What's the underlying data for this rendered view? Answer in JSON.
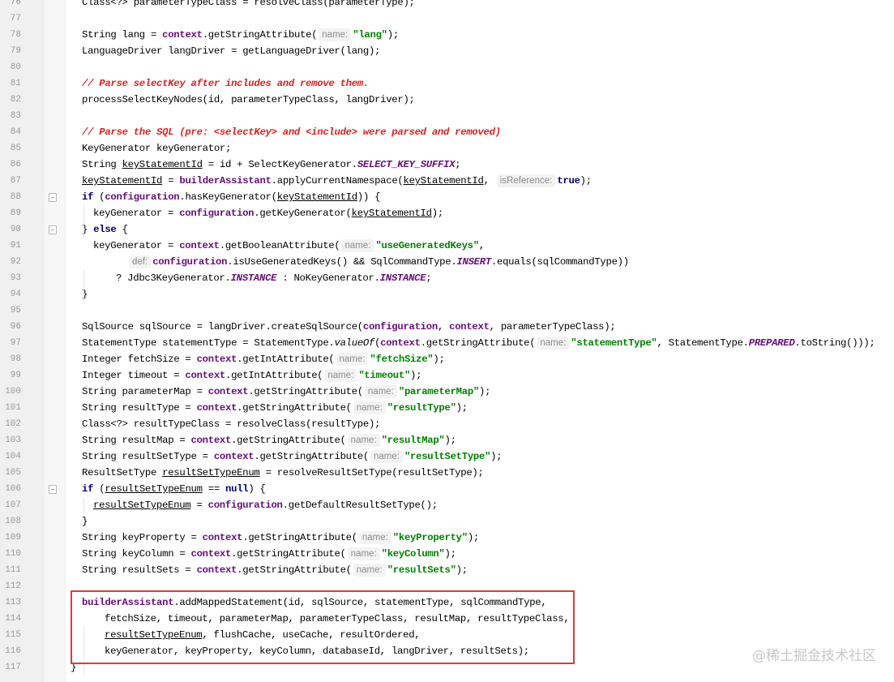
{
  "editor": {
    "lines": [
      {
        "num": "76",
        "fold": false,
        "indent": 0,
        "tokens": [
          {
            "t": "Class<?> parameterTypeClass = resolveClass(parameterType);",
            "c": ""
          }
        ]
      },
      {
        "num": "77",
        "fold": false,
        "indent": 0,
        "tokens": []
      },
      {
        "num": "78",
        "fold": false,
        "indent": 0,
        "tokens": [
          {
            "t": "String lang = ",
            "c": ""
          },
          {
            "t": "context",
            "c": "fld"
          },
          {
            "t": ".getStringAttribute(",
            "c": ""
          },
          {
            "t": "name:",
            "c": "hint"
          },
          {
            "t": "\"lang\"",
            "c": "str"
          },
          {
            "t": ");",
            "c": ""
          }
        ]
      },
      {
        "num": "79",
        "fold": false,
        "indent": 0,
        "tokens": [
          {
            "t": "LanguageDriver langDriver = getLanguageDriver(lang);",
            "c": ""
          }
        ]
      },
      {
        "num": "80",
        "fold": false,
        "indent": 0,
        "tokens": []
      },
      {
        "num": "81",
        "fold": false,
        "indent": 0,
        "tokens": [
          {
            "t": "// Parse selectKey after includes and remove them.",
            "c": "cmt"
          }
        ]
      },
      {
        "num": "82",
        "fold": false,
        "indent": 0,
        "tokens": [
          {
            "t": "processSelectKeyNodes(id, parameterTypeClass, langDriver);",
            "c": ""
          }
        ]
      },
      {
        "num": "83",
        "fold": false,
        "indent": 0,
        "tokens": []
      },
      {
        "num": "84",
        "fold": false,
        "indent": 0,
        "tokens": [
          {
            "t": "// Parse the SQL (pre: <selectKey> and <include> were parsed and removed)",
            "c": "cmt"
          }
        ]
      },
      {
        "num": "85",
        "fold": false,
        "indent": 0,
        "tokens": [
          {
            "t": "KeyGenerator keyGenerator;",
            "c": ""
          }
        ]
      },
      {
        "num": "86",
        "fold": false,
        "indent": 0,
        "tokens": [
          {
            "t": "String ",
            "c": ""
          },
          {
            "t": "keyStatementId",
            "c": "under"
          },
          {
            "t": " = id + SelectKeyGenerator.",
            "c": ""
          },
          {
            "t": "SELECT_KEY_SUFFIX",
            "c": "sfld"
          },
          {
            "t": ";",
            "c": ""
          }
        ]
      },
      {
        "num": "87",
        "fold": false,
        "indent": 0,
        "tokens": [
          {
            "t": "keyStatementId",
            "c": "under"
          },
          {
            "t": " = ",
            "c": ""
          },
          {
            "t": "builderAssistant",
            "c": "fld"
          },
          {
            "t": ".applyCurrentNamespace(",
            "c": ""
          },
          {
            "t": "keyStatementId",
            "c": "under"
          },
          {
            "t": ", ",
            "c": ""
          },
          {
            "t": "isReference:",
            "c": "hint"
          },
          {
            "t": "true",
            "c": "kw"
          },
          {
            "t": ");",
            "c": ""
          }
        ]
      },
      {
        "num": "88",
        "fold": true,
        "indent": 0,
        "tokens": [
          {
            "t": "if",
            "c": "kw"
          },
          {
            "t": " (",
            "c": ""
          },
          {
            "t": "configuration",
            "c": "fld"
          },
          {
            "t": ".hasKeyGenerator(",
            "c": ""
          },
          {
            "t": "keyStatementId",
            "c": "under"
          },
          {
            "t": ")) {",
            "c": ""
          }
        ]
      },
      {
        "num": "89",
        "fold": false,
        "indent": 1,
        "tokens": [
          {
            "t": "keyGenerator = ",
            "c": ""
          },
          {
            "t": "configuration",
            "c": "fld"
          },
          {
            "t": ".getKeyGenerator(",
            "c": ""
          },
          {
            "t": "keyStatementId",
            "c": "under"
          },
          {
            "t": ");",
            "c": ""
          }
        ]
      },
      {
        "num": "90",
        "fold": true,
        "indent": 0,
        "tokens": [
          {
            "t": "} ",
            "c": ""
          },
          {
            "t": "else",
            "c": "kw"
          },
          {
            "t": " {",
            "c": ""
          }
        ]
      },
      {
        "num": "91",
        "fold": false,
        "indent": 1,
        "tokens": [
          {
            "t": "keyGenerator = ",
            "c": ""
          },
          {
            "t": "context",
            "c": "fld"
          },
          {
            "t": ".getBooleanAttribute(",
            "c": ""
          },
          {
            "t": "name:",
            "c": "hint"
          },
          {
            "t": "\"useGeneratedKeys\"",
            "c": "str"
          },
          {
            "t": ",",
            "c": ""
          }
        ]
      },
      {
        "num": "92",
        "fold": false,
        "indent": 4,
        "tokens": [
          {
            "t": "def:",
            "c": "hint"
          },
          {
            "t": "configuration",
            "c": "fld"
          },
          {
            "t": ".isUseGeneratedKeys() && SqlCommandType.",
            "c": ""
          },
          {
            "t": "INSERT",
            "c": "sfld"
          },
          {
            "t": ".equals(sqlCommandType))",
            "c": ""
          }
        ]
      },
      {
        "num": "93",
        "fold": false,
        "indent": 3,
        "tokens": [
          {
            "t": "? Jdbc3KeyGenerator.",
            "c": ""
          },
          {
            "t": "INSTANCE",
            "c": "sfld"
          },
          {
            "t": " : NoKeyGenerator.",
            "c": ""
          },
          {
            "t": "INSTANCE",
            "c": "sfld"
          },
          {
            "t": ";",
            "c": ""
          }
        ]
      },
      {
        "num": "94",
        "fold": false,
        "indent": 0,
        "tokens": [
          {
            "t": "}",
            "c": ""
          }
        ]
      },
      {
        "num": "95",
        "fold": false,
        "indent": 0,
        "tokens": []
      },
      {
        "num": "96",
        "fold": false,
        "indent": 0,
        "tokens": [
          {
            "t": "SqlSource sqlSource = langDriver.createSqlSource(",
            "c": ""
          },
          {
            "t": "configuration",
            "c": "fld"
          },
          {
            "t": ", ",
            "c": ""
          },
          {
            "t": "context",
            "c": "fld"
          },
          {
            "t": ", parameterTypeClass);",
            "c": ""
          }
        ]
      },
      {
        "num": "97",
        "fold": false,
        "indent": 0,
        "tokens": [
          {
            "t": "StatementType statementType = StatementType.",
            "c": ""
          },
          {
            "t": "valueOf",
            "c": "ital"
          },
          {
            "t": "(",
            "c": ""
          },
          {
            "t": "context",
            "c": "fld"
          },
          {
            "t": ".getStringAttribute(",
            "c": ""
          },
          {
            "t": "name:",
            "c": "hint"
          },
          {
            "t": "\"statementType\"",
            "c": "str"
          },
          {
            "t": ", StatementType.",
            "c": ""
          },
          {
            "t": "PREPARED",
            "c": "sfld"
          },
          {
            "t": ".toString()));",
            "c": ""
          }
        ]
      },
      {
        "num": "98",
        "fold": false,
        "indent": 0,
        "tokens": [
          {
            "t": "Integer fetchSize = ",
            "c": ""
          },
          {
            "t": "context",
            "c": "fld"
          },
          {
            "t": ".getIntAttribute(",
            "c": ""
          },
          {
            "t": "name:",
            "c": "hint"
          },
          {
            "t": "\"fetchSize\"",
            "c": "str"
          },
          {
            "t": ");",
            "c": ""
          }
        ]
      },
      {
        "num": "99",
        "fold": false,
        "indent": 0,
        "tokens": [
          {
            "t": "Integer timeout = ",
            "c": ""
          },
          {
            "t": "context",
            "c": "fld"
          },
          {
            "t": ".getIntAttribute(",
            "c": ""
          },
          {
            "t": "name:",
            "c": "hint"
          },
          {
            "t": "\"timeout\"",
            "c": "str"
          },
          {
            "t": ");",
            "c": ""
          }
        ]
      },
      {
        "num": "100",
        "fold": false,
        "indent": 0,
        "tokens": [
          {
            "t": "String parameterMap = ",
            "c": ""
          },
          {
            "t": "context",
            "c": "fld"
          },
          {
            "t": ".getStringAttribute(",
            "c": ""
          },
          {
            "t": "name:",
            "c": "hint"
          },
          {
            "t": "\"parameterMap\"",
            "c": "str"
          },
          {
            "t": ");",
            "c": ""
          }
        ]
      },
      {
        "num": "101",
        "fold": false,
        "indent": 0,
        "tokens": [
          {
            "t": "String resultType = ",
            "c": ""
          },
          {
            "t": "context",
            "c": "fld"
          },
          {
            "t": ".getStringAttribute(",
            "c": ""
          },
          {
            "t": "name:",
            "c": "hint"
          },
          {
            "t": "\"resultType\"",
            "c": "str"
          },
          {
            "t": ");",
            "c": ""
          }
        ]
      },
      {
        "num": "102",
        "fold": false,
        "indent": 0,
        "tokens": [
          {
            "t": "Class<?> resultTypeClass = resolveClass(resultType);",
            "c": ""
          }
        ]
      },
      {
        "num": "103",
        "fold": false,
        "indent": 0,
        "tokens": [
          {
            "t": "String resultMap = ",
            "c": ""
          },
          {
            "t": "context",
            "c": "fld"
          },
          {
            "t": ".getStringAttribute(",
            "c": ""
          },
          {
            "t": "name:",
            "c": "hint"
          },
          {
            "t": "\"resultMap\"",
            "c": "str"
          },
          {
            "t": ");",
            "c": ""
          }
        ]
      },
      {
        "num": "104",
        "fold": false,
        "indent": 0,
        "tokens": [
          {
            "t": "String resultSetType = ",
            "c": ""
          },
          {
            "t": "context",
            "c": "fld"
          },
          {
            "t": ".getStringAttribute(",
            "c": ""
          },
          {
            "t": "name:",
            "c": "hint"
          },
          {
            "t": "\"resultSetType\"",
            "c": "str"
          },
          {
            "t": ");",
            "c": ""
          }
        ]
      },
      {
        "num": "105",
        "fold": false,
        "indent": 0,
        "tokens": [
          {
            "t": "ResultSetType ",
            "c": ""
          },
          {
            "t": "resultSetTypeEnum",
            "c": "under"
          },
          {
            "t": " = resolveResultSetType(resultSetType);",
            "c": ""
          }
        ]
      },
      {
        "num": "106",
        "fold": true,
        "indent": 0,
        "tokens": [
          {
            "t": "if",
            "c": "kw"
          },
          {
            "t": " (",
            "c": ""
          },
          {
            "t": "resultSetTypeEnum",
            "c": "under"
          },
          {
            "t": " == ",
            "c": ""
          },
          {
            "t": "null",
            "c": "kw"
          },
          {
            "t": ") {",
            "c": ""
          }
        ]
      },
      {
        "num": "107",
        "fold": false,
        "indent": 1,
        "tokens": [
          {
            "t": "resultSetTypeEnum",
            "c": "under"
          },
          {
            "t": " = ",
            "c": ""
          },
          {
            "t": "configuration",
            "c": "fld"
          },
          {
            "t": ".getDefaultResultSetType();",
            "c": ""
          }
        ]
      },
      {
        "num": "108",
        "fold": false,
        "indent": 0,
        "tokens": [
          {
            "t": "}",
            "c": ""
          }
        ]
      },
      {
        "num": "109",
        "fold": false,
        "indent": 0,
        "tokens": [
          {
            "t": "String keyProperty = ",
            "c": ""
          },
          {
            "t": "context",
            "c": "fld"
          },
          {
            "t": ".getStringAttribute(",
            "c": ""
          },
          {
            "t": "name:",
            "c": "hint"
          },
          {
            "t": "\"keyProperty\"",
            "c": "str"
          },
          {
            "t": ");",
            "c": ""
          }
        ]
      },
      {
        "num": "110",
        "fold": false,
        "indent": 0,
        "tokens": [
          {
            "t": "String keyColumn = ",
            "c": ""
          },
          {
            "t": "context",
            "c": "fld"
          },
          {
            "t": ".getStringAttribute(",
            "c": ""
          },
          {
            "t": "name:",
            "c": "hint"
          },
          {
            "t": "\"keyColumn\"",
            "c": "str"
          },
          {
            "t": ");",
            "c": ""
          }
        ]
      },
      {
        "num": "111",
        "fold": false,
        "indent": 0,
        "tokens": [
          {
            "t": "String resultSets = ",
            "c": ""
          },
          {
            "t": "context",
            "c": "fld"
          },
          {
            "t": ".getStringAttribute(",
            "c": ""
          },
          {
            "t": "name:",
            "c": "hint"
          },
          {
            "t": "\"resultSets\"",
            "c": "str"
          },
          {
            "t": ");",
            "c": ""
          }
        ]
      },
      {
        "num": "112",
        "fold": false,
        "indent": 0,
        "tokens": []
      },
      {
        "num": "113",
        "fold": false,
        "indent": 0,
        "tokens": [
          {
            "t": "builderAssistant",
            "c": "fld"
          },
          {
            "t": ".addMappedStatement(id, sqlSource, statementType, sqlCommandType,",
            "c": ""
          }
        ]
      },
      {
        "num": "114",
        "fold": false,
        "indent": 2,
        "tokens": [
          {
            "t": "fetchSize, timeout, parameterMap, parameterTypeClass, resultMap, resultTypeClass,",
            "c": ""
          }
        ]
      },
      {
        "num": "115",
        "fold": false,
        "indent": 2,
        "tokens": [
          {
            "t": "resultSetTypeEnum",
            "c": "under"
          },
          {
            "t": ", flushCache, useCache, resultOrdered,",
            "c": ""
          }
        ]
      },
      {
        "num": "116",
        "fold": false,
        "indent": 2,
        "tokens": [
          {
            "t": "keyGenerator, keyProperty, keyColumn, databaseId, langDriver, resultSets);",
            "c": ""
          }
        ]
      },
      {
        "num": "117",
        "fold": false,
        "indent": -1,
        "tokens": [
          {
            "t": "}",
            "c": ""
          }
        ]
      }
    ]
  },
  "highlight": {
    "color": "#e53935",
    "label": "highlighted-addMappedStatement-call"
  },
  "watermark": {
    "text": "@稀土掘金技术社区"
  },
  "colors": {
    "keyword": "#000080",
    "field": "#660e7a",
    "string": "#008000",
    "comment": "#e02020",
    "hint_bg": "#f3f3f3",
    "hint_text": "#8c8c8c",
    "line_number": "#999999"
  }
}
